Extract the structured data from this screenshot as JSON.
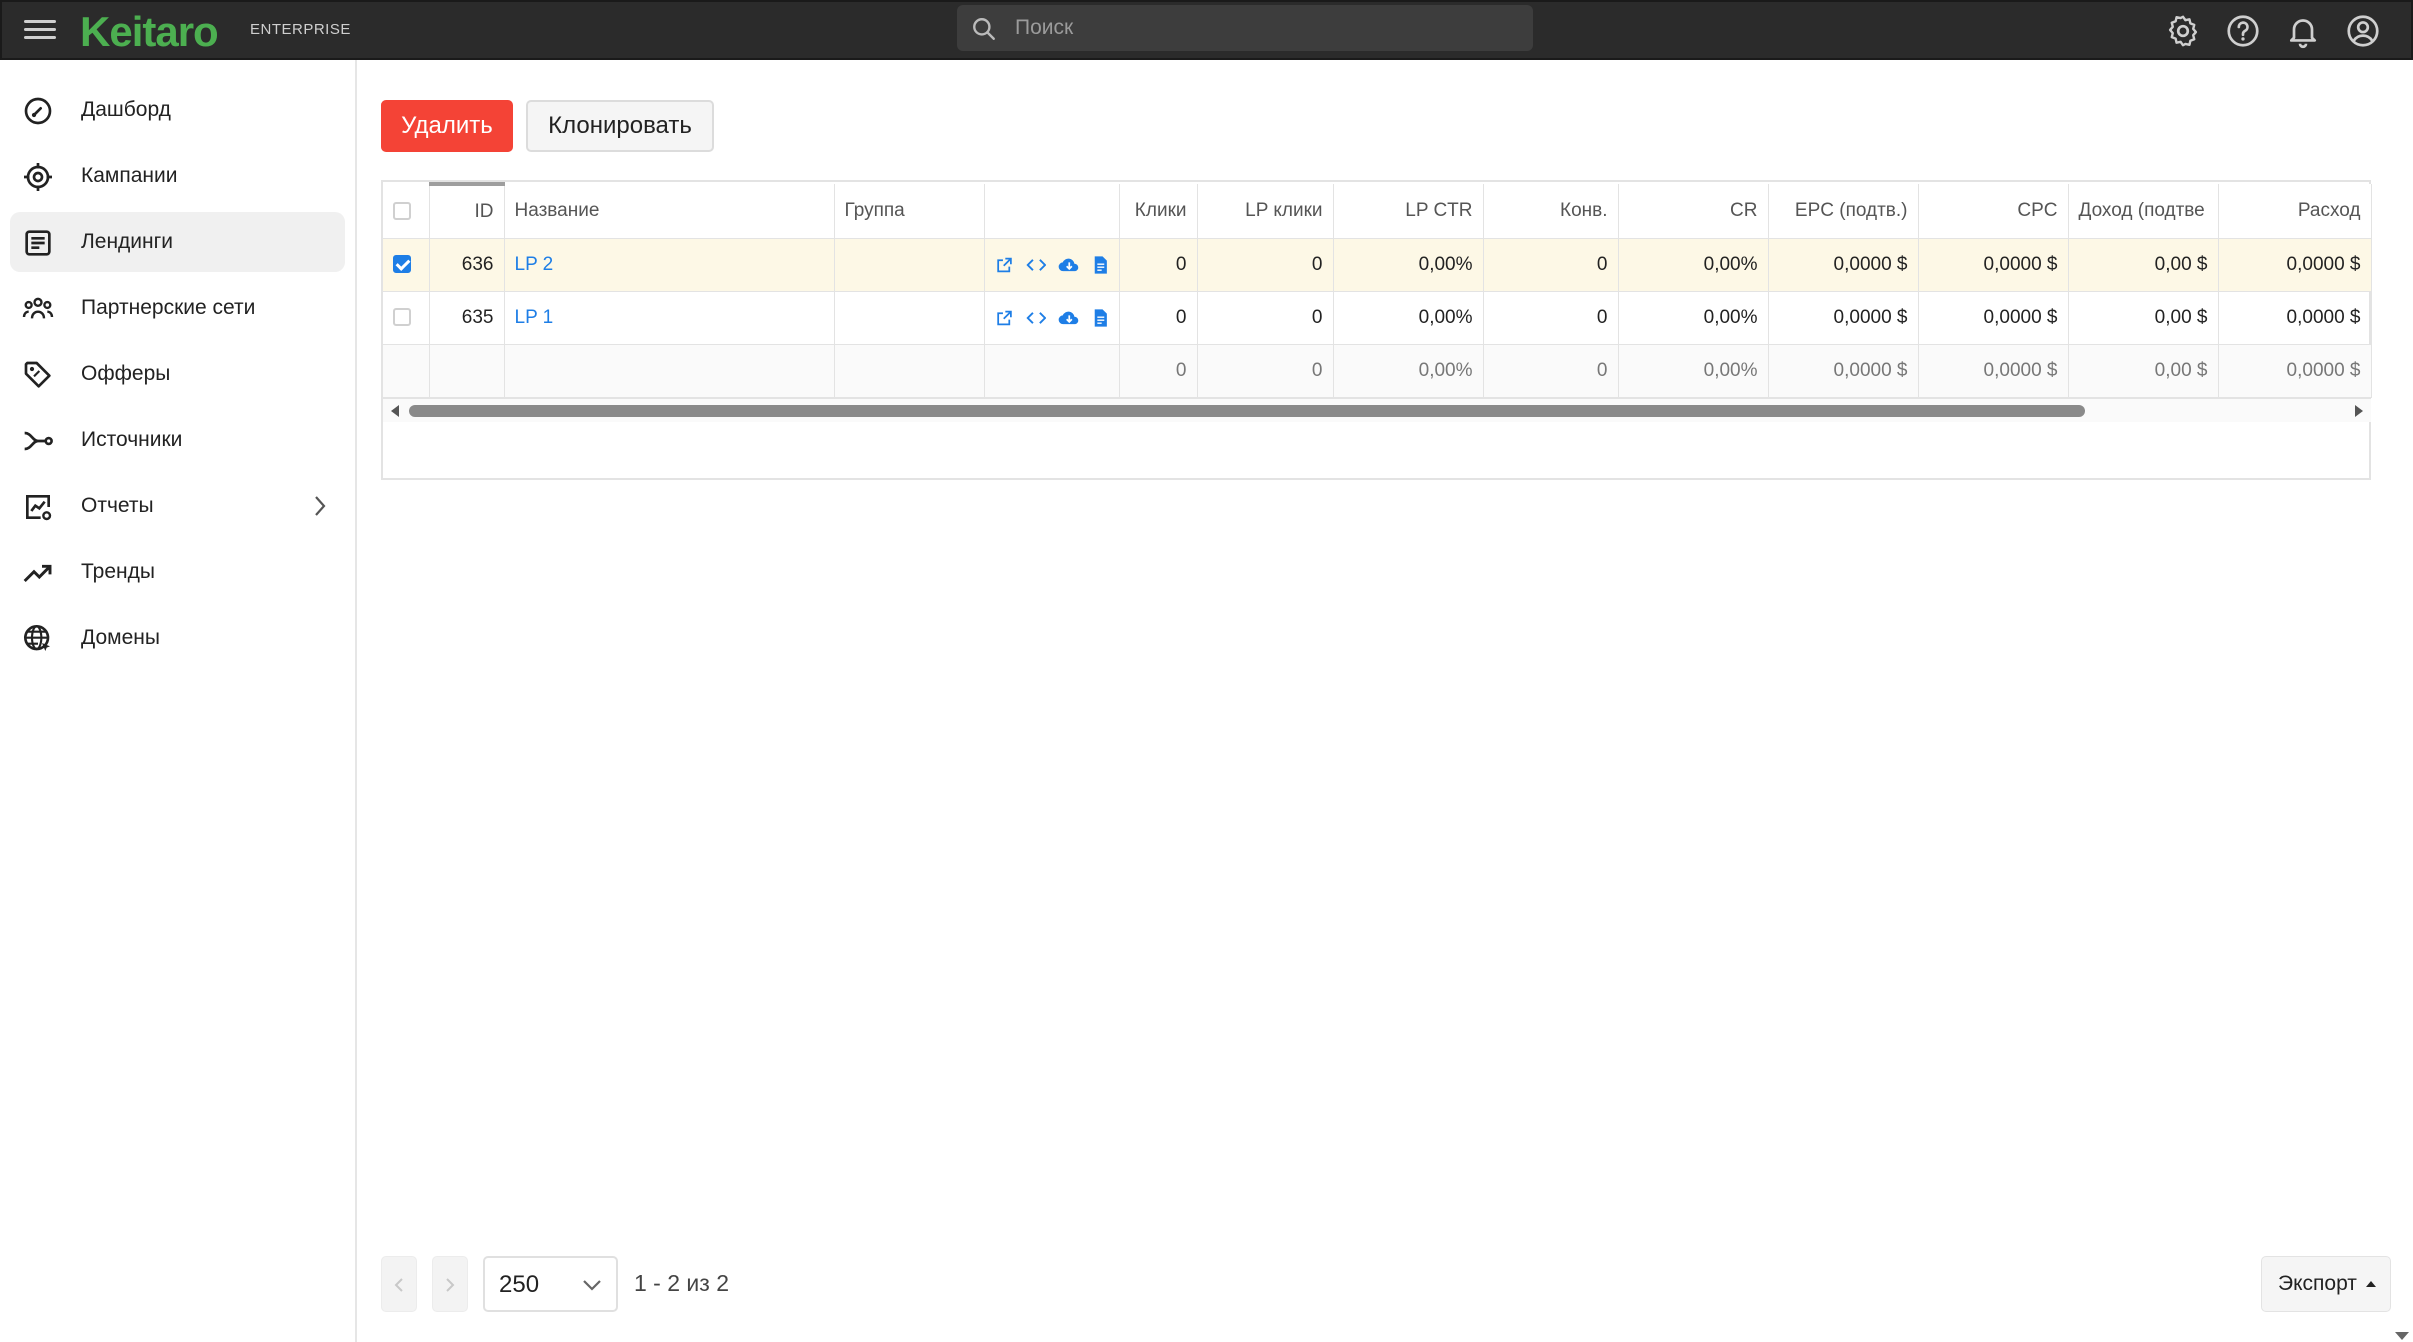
{
  "header": {
    "logo": "Keitaro",
    "edition": "ENTERPRISE",
    "search_placeholder": "Поиск",
    "icons": [
      "gear-icon",
      "help-icon",
      "bell-icon",
      "account-icon"
    ]
  },
  "sidebar": {
    "items": [
      {
        "label": "Дашборд",
        "icon": "dashboard-icon",
        "active": false
      },
      {
        "label": "Кампании",
        "icon": "target-icon",
        "active": false
      },
      {
        "label": "Лендинги",
        "icon": "landing-icon",
        "active": true
      },
      {
        "label": "Партнерские сети",
        "icon": "people-icon",
        "active": false
      },
      {
        "label": "Офферы",
        "icon": "tag-icon",
        "active": false
      },
      {
        "label": "Источники",
        "icon": "source-icon",
        "active": false
      },
      {
        "label": "Отчеты",
        "icon": "report-icon",
        "active": false,
        "expandable": true
      },
      {
        "label": "Тренды",
        "icon": "trend-icon",
        "active": false
      },
      {
        "label": "Домены",
        "icon": "globe-icon",
        "active": false
      }
    ]
  },
  "toolbar": {
    "delete_label": "Удалить",
    "clone_label": "Клонировать"
  },
  "table": {
    "columns": [
      "ID",
      "Название",
      "Группа",
      "",
      "Клики",
      "LP клики",
      "LP CTR",
      "Конв.",
      "CR",
      "EPC (подтв.)",
      "CPC",
      "Доход (подтве",
      "Расход"
    ],
    "rows": [
      {
        "selected": true,
        "id": "636",
        "name": "LP 2",
        "group": "",
        "clicks": "0",
        "lp_clicks": "0",
        "lp_ctr": "0,00%",
        "conv": "0",
        "cr": "0,00%",
        "epc": "0,0000 $",
        "cpc": "0,0000 $",
        "revenue": "0,00 $",
        "cost": "0,0000 $"
      },
      {
        "selected": false,
        "id": "635",
        "name": "LP 1",
        "group": "",
        "clicks": "0",
        "lp_clicks": "0",
        "lp_ctr": "0,00%",
        "conv": "0",
        "cr": "0,00%",
        "epc": "0,0000 $",
        "cpc": "0,0000 $",
        "revenue": "0,00 $",
        "cost": "0,0000 $"
      }
    ],
    "totals": {
      "clicks": "0",
      "lp_clicks": "0",
      "lp_ctr": "0,00%",
      "conv": "0",
      "cr": "0,00%",
      "epc": "0,0000 $",
      "cpc": "0,0000 $",
      "revenue": "0,00 $",
      "cost": "0,0000 $"
    }
  },
  "pagination": {
    "per_page": "250",
    "range": "1 - 2 из 2"
  },
  "export_label": "Экспорт",
  "colors": {
    "accent": "#1e7ee6",
    "danger": "#f44336",
    "brand": "#4caf50",
    "selected_row": "#fdf8e6"
  }
}
